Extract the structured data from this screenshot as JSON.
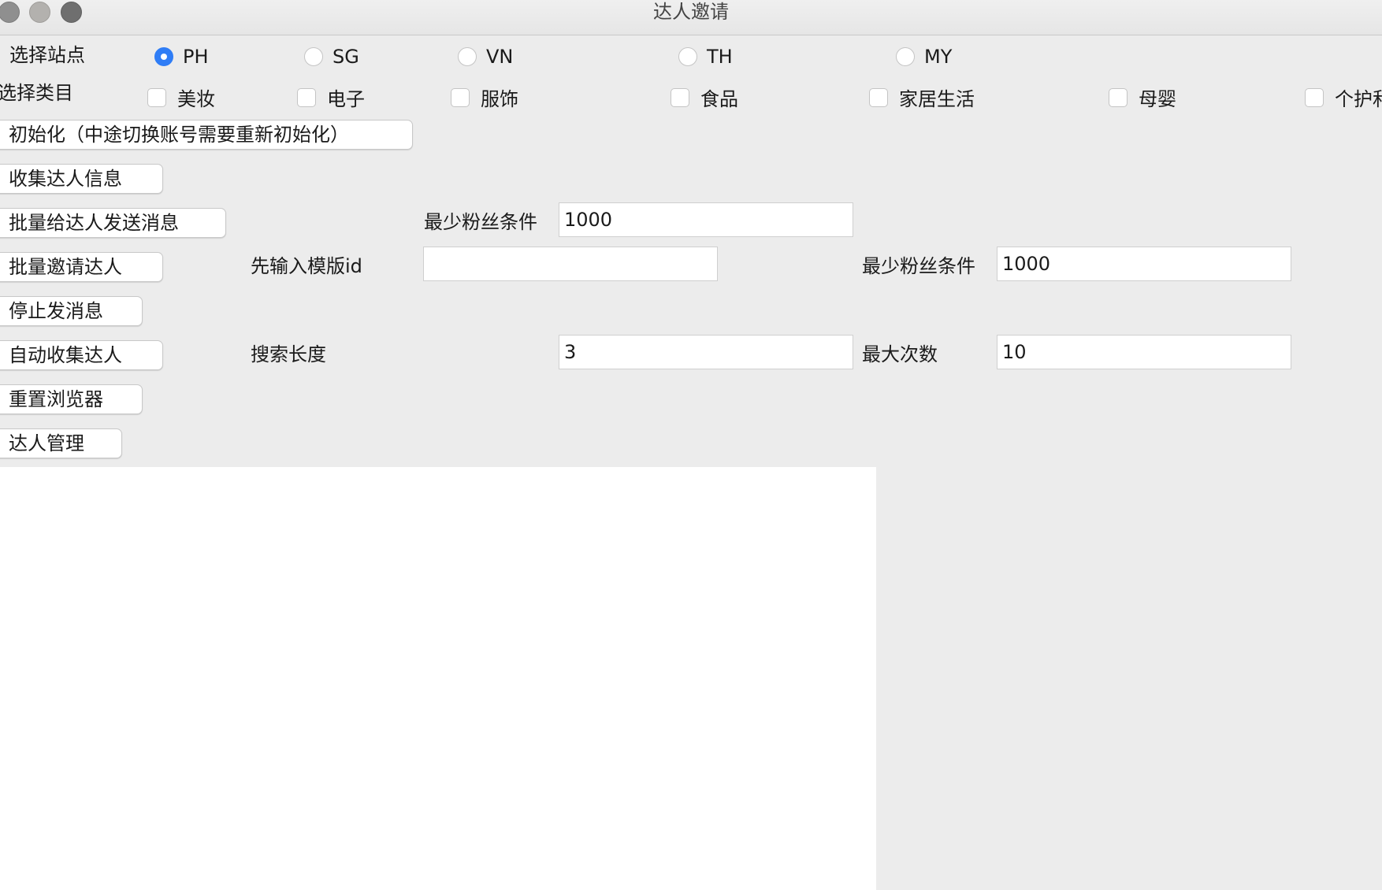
{
  "window": {
    "title": "达人邀请"
  },
  "site": {
    "label": "选择站点",
    "options": [
      "PH",
      "SG",
      "VN",
      "TH",
      "MY"
    ],
    "selected": "PH"
  },
  "category": {
    "label": "选择类目",
    "options": [
      "美妆",
      "电子",
      "服饰",
      "食品",
      "家居生活",
      "母婴",
      "个护和"
    ]
  },
  "buttons": {
    "init": "初始化（中途切换账号需要重新初始化）",
    "collect": "收集达人信息",
    "batch_message": "批量给达人发送消息",
    "batch_invite": "批量邀请达人",
    "stop_message": "停止发消息",
    "auto_collect": "自动收集达人",
    "reset_browser": "重置浏览器",
    "manage": "达人管理"
  },
  "fields": {
    "message_min_fans": {
      "label": "最少粉丝条件",
      "value": "1000"
    },
    "template_id": {
      "label": "先输入模版id",
      "value": ""
    },
    "invite_min_fans": {
      "label": "最少粉丝条件",
      "value": "1000"
    },
    "search_length": {
      "label": "搜索长度",
      "value": "3"
    },
    "max_count": {
      "label": "最大次数",
      "value": "10"
    }
  }
}
